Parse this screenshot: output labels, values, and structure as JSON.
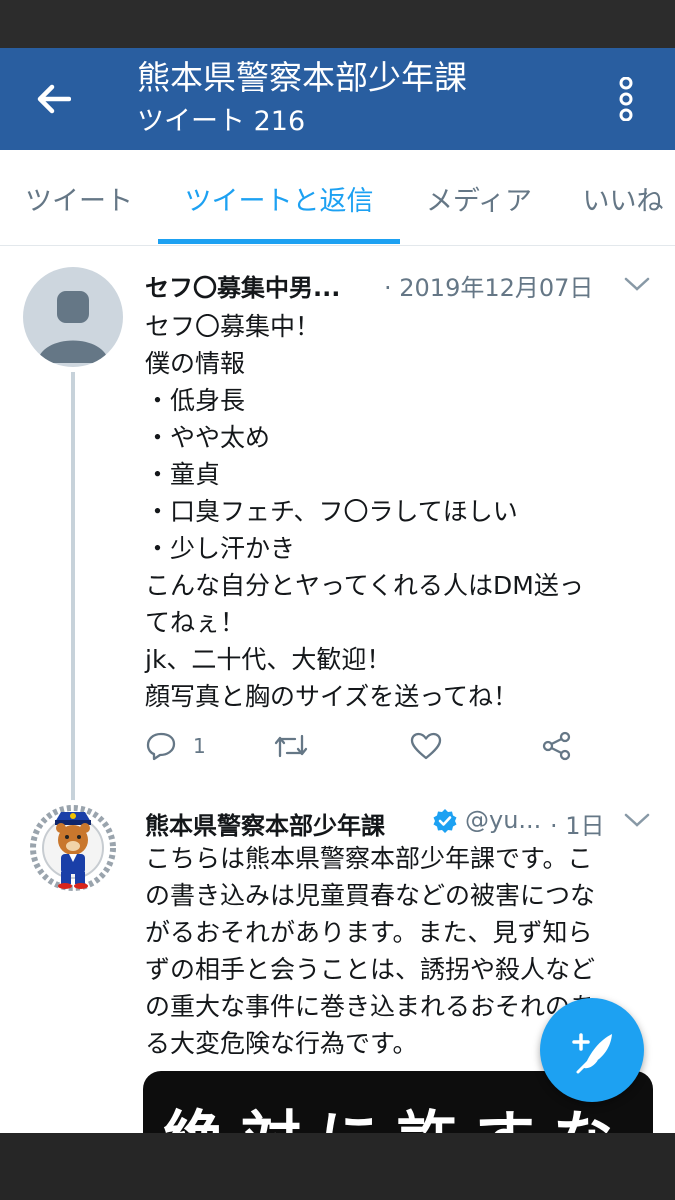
{
  "header": {
    "title": "熊本県警察本部少年課",
    "subtitle": "ツイート 216",
    "back_icon": "arrow-left-icon",
    "more_icon": "more-vertical-icon"
  },
  "tabs": [
    {
      "label": "ツイート",
      "active": false
    },
    {
      "label": "ツイートと返信",
      "active": true
    },
    {
      "label": "メディア",
      "active": false
    },
    {
      "label": "いいね",
      "active": false
    }
  ],
  "tweets": [
    {
      "name": "セフ〇募集中男...",
      "date": "· 2019年12月07日",
      "lines": [
        "セフ〇募集中！",
        "僕の情報",
        "・低身長",
        "・やや太め",
        "・童貞",
        "・口臭フェチ、フ〇ラしてほしい",
        "・少し汗かき",
        "こんな自分とヤってくれる人はDM送っ",
        "てねぇ！",
        "jk、二十代、大歓迎！",
        "顔写真と胸のサイズを送ってね！"
      ],
      "reply_count": "1"
    },
    {
      "name": "熊本県警察本部少年課",
      "handle": "@yu...",
      "date": "· 1日",
      "lines": [
        "こちらは熊本県警察本部少年課です。こ",
        "の書き込みは児童買春などの被害につな",
        "がるおそれがあります。また、見ず知ら",
        "ずの相手と会うことは、誘拐や殺人など",
        "の重大な事件に巻き込まれるおそれのあ",
        "る大変危険な行為です。"
      ],
      "image_text": "絶対に許すな"
    }
  ],
  "colors": {
    "header_bg": "#295ea0",
    "accent": "#1da1f2",
    "secondary_text": "#657786"
  }
}
